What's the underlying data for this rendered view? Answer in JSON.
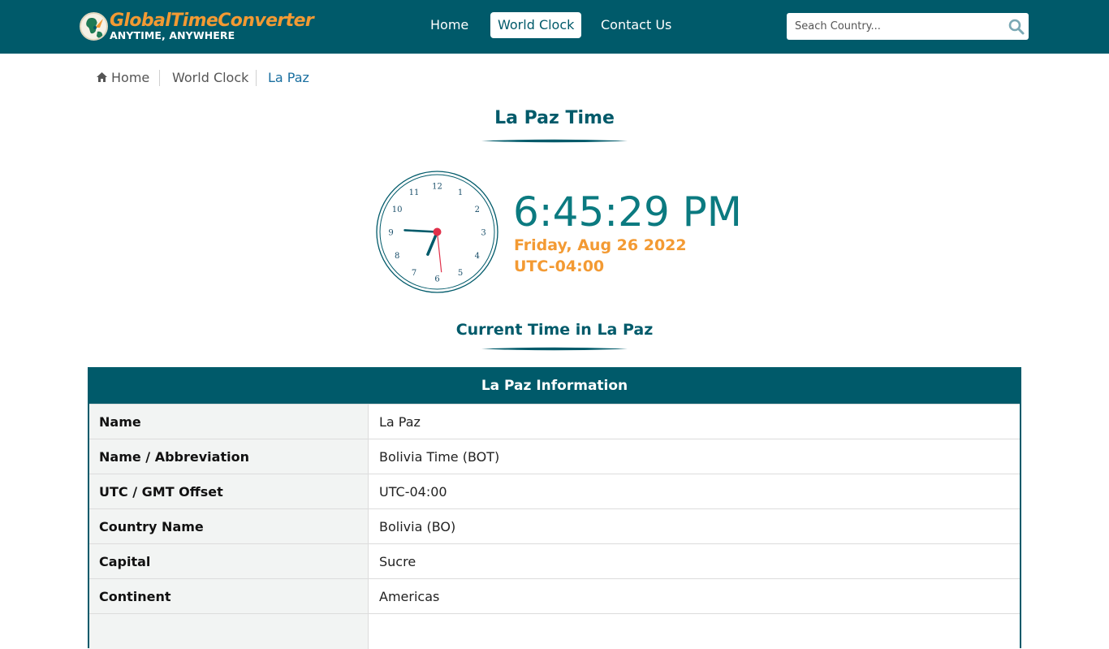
{
  "header": {
    "logo_title": "GlobalTimeConverter",
    "logo_subtitle": "ANYTIME, ANYWHERE",
    "nav": [
      "Home",
      "World Clock",
      "Contact Us"
    ],
    "search_placeholder": "Seach Country..."
  },
  "breadcrumb": [
    "Home",
    "World Clock",
    "La Paz"
  ],
  "title": "La Paz Time",
  "clock": {
    "time": "6:45:29 PM",
    "date": "Friday, Aug 26 2022",
    "offset": "UTC-04:00",
    "hour": 18,
    "minute": 45,
    "second": 29,
    "numbers": [
      "12",
      "1",
      "2",
      "3",
      "4",
      "5",
      "6",
      "7",
      "8",
      "9",
      "10",
      "11"
    ]
  },
  "section_title": "Current Time in La Paz",
  "info": {
    "heading": "La Paz Information",
    "rows": [
      {
        "key": "Name",
        "value": "La Paz"
      },
      {
        "key": "Name / Abbreviation",
        "value": "Bolivia Time (BOT)"
      },
      {
        "key": "UTC / GMT Offset",
        "value": "UTC-04:00"
      },
      {
        "key": "Country Name",
        "value": "Bolivia (BO)"
      },
      {
        "key": "Capital",
        "value": "Sucre"
      },
      {
        "key": "Continent",
        "value": "Americas"
      },
      {
        "key": "",
        "value": ""
      }
    ]
  },
  "colors": {
    "brand": "#005a6a",
    "accent": "#f39a33",
    "clock_time": "#0b7a80",
    "second_hand": "#e0304a"
  }
}
